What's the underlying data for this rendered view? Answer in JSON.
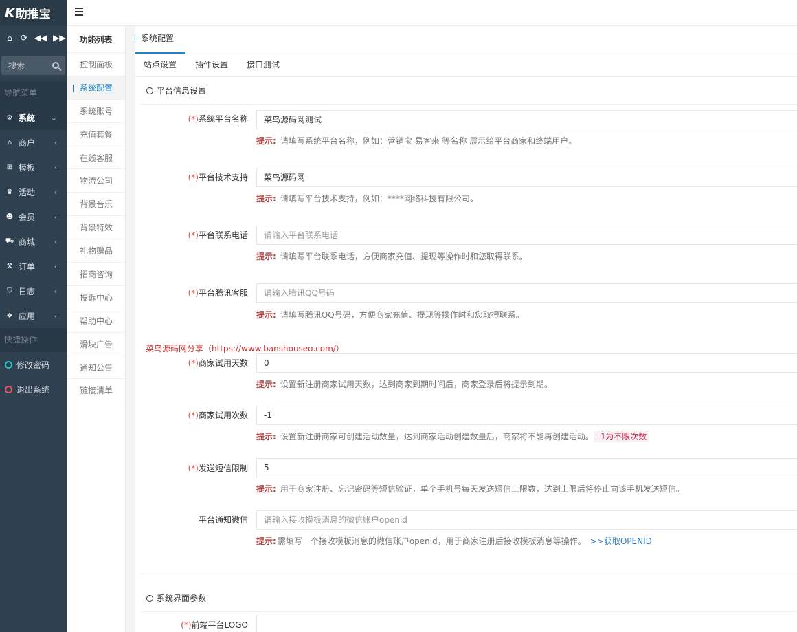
{
  "brand": {
    "logo_mark": "K",
    "logo_text": "助推宝"
  },
  "sidebar": {
    "search_placeholder": "搜索",
    "nav_section": "导航菜单",
    "nav": [
      {
        "label": "系统",
        "icon": "⚙",
        "arrow": "⌄"
      },
      {
        "label": "商户",
        "icon": "⌂",
        "arrow": "‹"
      },
      {
        "label": "模板",
        "icon": "⊞",
        "arrow": "‹"
      },
      {
        "label": "活动",
        "icon": "♛",
        "arrow": "‹"
      },
      {
        "label": "会员",
        "icon": "☻",
        "arrow": "‹"
      },
      {
        "label": "商城",
        "icon": "⛟",
        "arrow": "‹"
      },
      {
        "label": "订单",
        "icon": "⚒",
        "arrow": "‹"
      },
      {
        "label": "日志",
        "icon": "⛉",
        "arrow": "‹"
      },
      {
        "label": "应用",
        "icon": "❖",
        "arrow": "‹"
      }
    ],
    "quick_section": "快捷操作",
    "quick": [
      {
        "label": "修改密码",
        "color": "#23c6c8"
      },
      {
        "label": "退出系统",
        "color": "#ed5565"
      }
    ]
  },
  "funclist": {
    "title": "功能列表",
    "items": [
      "控制面板",
      "系统配置",
      "系统账号",
      "充值套餐",
      "在线客服",
      "物流公司",
      "背景音乐",
      "背景特效",
      "礼物赠品",
      "招商咨询",
      "投诉中心",
      "帮助中心",
      "滑块广告",
      "通知公告",
      "链接清单"
    ]
  },
  "panel": {
    "title": "系统配置",
    "tabs": [
      "站点设置",
      "插件设置",
      "接口测试"
    ],
    "section1": "平台信息设置",
    "section2": "系统界面参数",
    "hint_key": "提示:",
    "req_mark": "(*)",
    "share_note": "菜鸟源码网分享（https://www.banshouseo.com/）",
    "fields": [
      {
        "label": "系统平台名称",
        "value": "菜鸟源码网测试",
        "placeholder": "",
        "hint": "请填写系统平台名称，例如：营销宝 易客来 等名称 展示给平台商家和终端用户。"
      },
      {
        "label": "平台技术支持",
        "value": "菜鸟源码网",
        "placeholder": "",
        "hint": "请填写平台技术支持，例如：****网络科技有限公司。"
      },
      {
        "label": "平台联系电话",
        "value": "",
        "placeholder": "请输入平台联系电话",
        "hint": "请填写平台联系电话，方便商家充值、提现等操作时和您取得联系。"
      },
      {
        "label": "平台腾讯客服",
        "value": "",
        "placeholder": "请输入腾讯QQ号码",
        "hint": "请填写腾讯QQ号码，方便商家充值、提现等操作时和您取得联系。"
      },
      {
        "label": "商家试用天数",
        "value": "0",
        "placeholder": "",
        "hint": "设置新注册商家试用天数，达到商家到期时间后，商家登录后将提示到期。"
      },
      {
        "label": "商家试用次数",
        "value": "-1",
        "placeholder": "",
        "hint": "设置新注册商家可创建活动数量，达到商家活动创建数量后，商家将不能再创建活动。",
        "hint_code": "-1为不限次数"
      },
      {
        "label": "发送短信限制",
        "value": "5",
        "placeholder": "",
        "hint": "用于商家注册、忘记密码等短信验证，单个手机号每天发送短信上限数，达到上限后将停止向该手机发送短信。"
      },
      {
        "label": "平台通知微信",
        "value": "",
        "placeholder": "请输入接收模板消息的微信账户openid",
        "hint": "需填写一个接收模板消息的微信账户openid，用于商家注册后接收模板消息等操作。",
        "hint_link": ">>获取OPENID"
      },
      {
        "label": "前端平台LOGO",
        "value": "",
        "placeholder": ""
      }
    ]
  },
  "colors": {
    "sidebar_bg": "#2f4050",
    "accent": "#1c84c6",
    "required": "#d9534f"
  }
}
